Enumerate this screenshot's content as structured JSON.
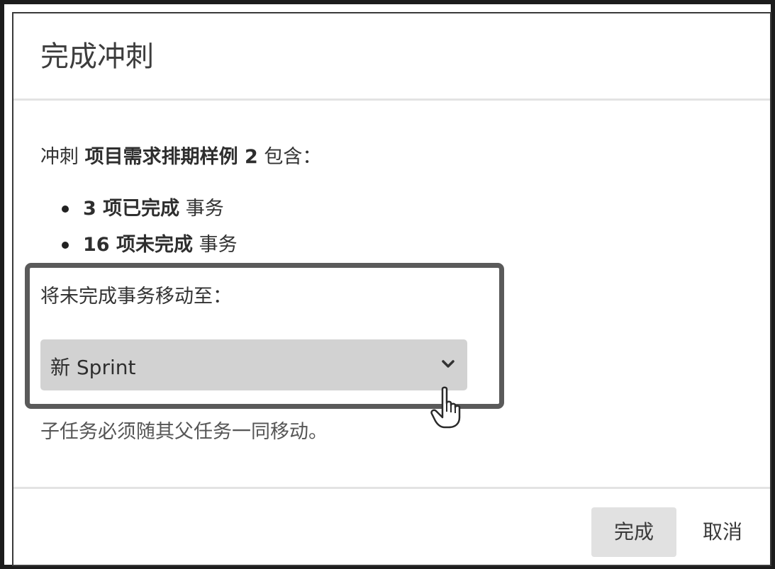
{
  "dialog": {
    "title": "完成冲刺"
  },
  "summary": {
    "prefix": "冲刺 ",
    "sprint_name": "项目需求排期样例 2",
    "suffix": " 包含："
  },
  "bullets": [
    {
      "bold": "3 项已完成",
      "rest": " 事务"
    },
    {
      "bold": "16 项未完成",
      "rest": " 事务"
    }
  ],
  "move": {
    "label": "将未完成事务移动至：",
    "selected": "新 Sprint",
    "note": "子任务必须随其父任务一同移动。"
  },
  "buttons": {
    "done": "完成",
    "cancel": "取消"
  },
  "icons": {
    "dropdown": "chevron-down-icon",
    "cursor": "hand-pointer-icon"
  }
}
